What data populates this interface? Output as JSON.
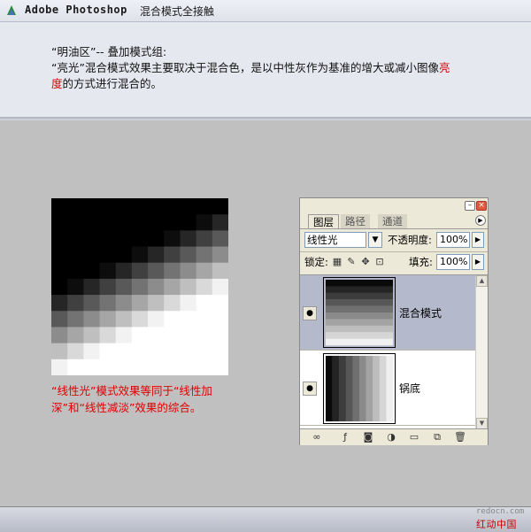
{
  "header": {
    "title_en": "Adobe Photoshop",
    "title_cn": "混合模式全接触"
  },
  "intro": {
    "line1": "“明油区”-- 叠加模式组:",
    "line2_a": "“亮光”混合模式效果主要取决于混合色，是以中性灰作为基准的增大或减小图像",
    "line2_red1": "亮",
    "line2_red2": "度",
    "line2_b": "的方式进行混合的。"
  },
  "caption": "“线性光”模式效果等同于“线性加深”和“线性减淡”效果的综合。",
  "panel": {
    "tabs": [
      "图层",
      "路径",
      "通道"
    ],
    "blend_mode": "线性光",
    "opacity_label": "不透明度:",
    "opacity_value": "100%",
    "lock_label": "锁定:",
    "fill_label": "填充:",
    "fill_value": "100%",
    "layers": [
      {
        "name": "混合模式",
        "selected": true
      },
      {
        "name": "锅底",
        "selected": false
      }
    ]
  },
  "watermark": {
    "site": "redocn.com",
    "name": "红动中国"
  },
  "colors": {
    "accent_red": "#d10000",
    "selected_layer": "#b5b9cc"
  }
}
